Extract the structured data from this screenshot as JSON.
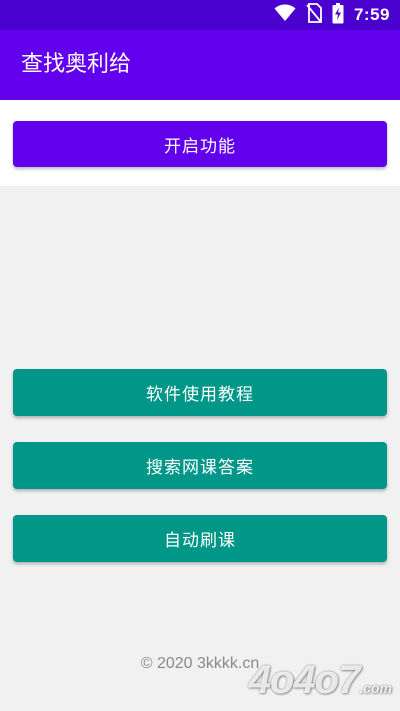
{
  "status_bar": {
    "time": "7:59",
    "icons": [
      "wifi-icon",
      "no-sim-icon",
      "battery-charging-icon"
    ],
    "color": "#4a00cf"
  },
  "app_bar": {
    "title": "查找奥利给",
    "color": "#6200ee"
  },
  "main": {
    "primary_button": "开启功能",
    "buttons": [
      "软件使用教程",
      "搜索网课答案",
      "自动刷课"
    ],
    "teal_color": "#009688"
  },
  "footer": {
    "copyright": "© 2020   3kkkk.cn"
  },
  "watermark": {
    "text": "4o4o7",
    "suffix": ".com"
  }
}
